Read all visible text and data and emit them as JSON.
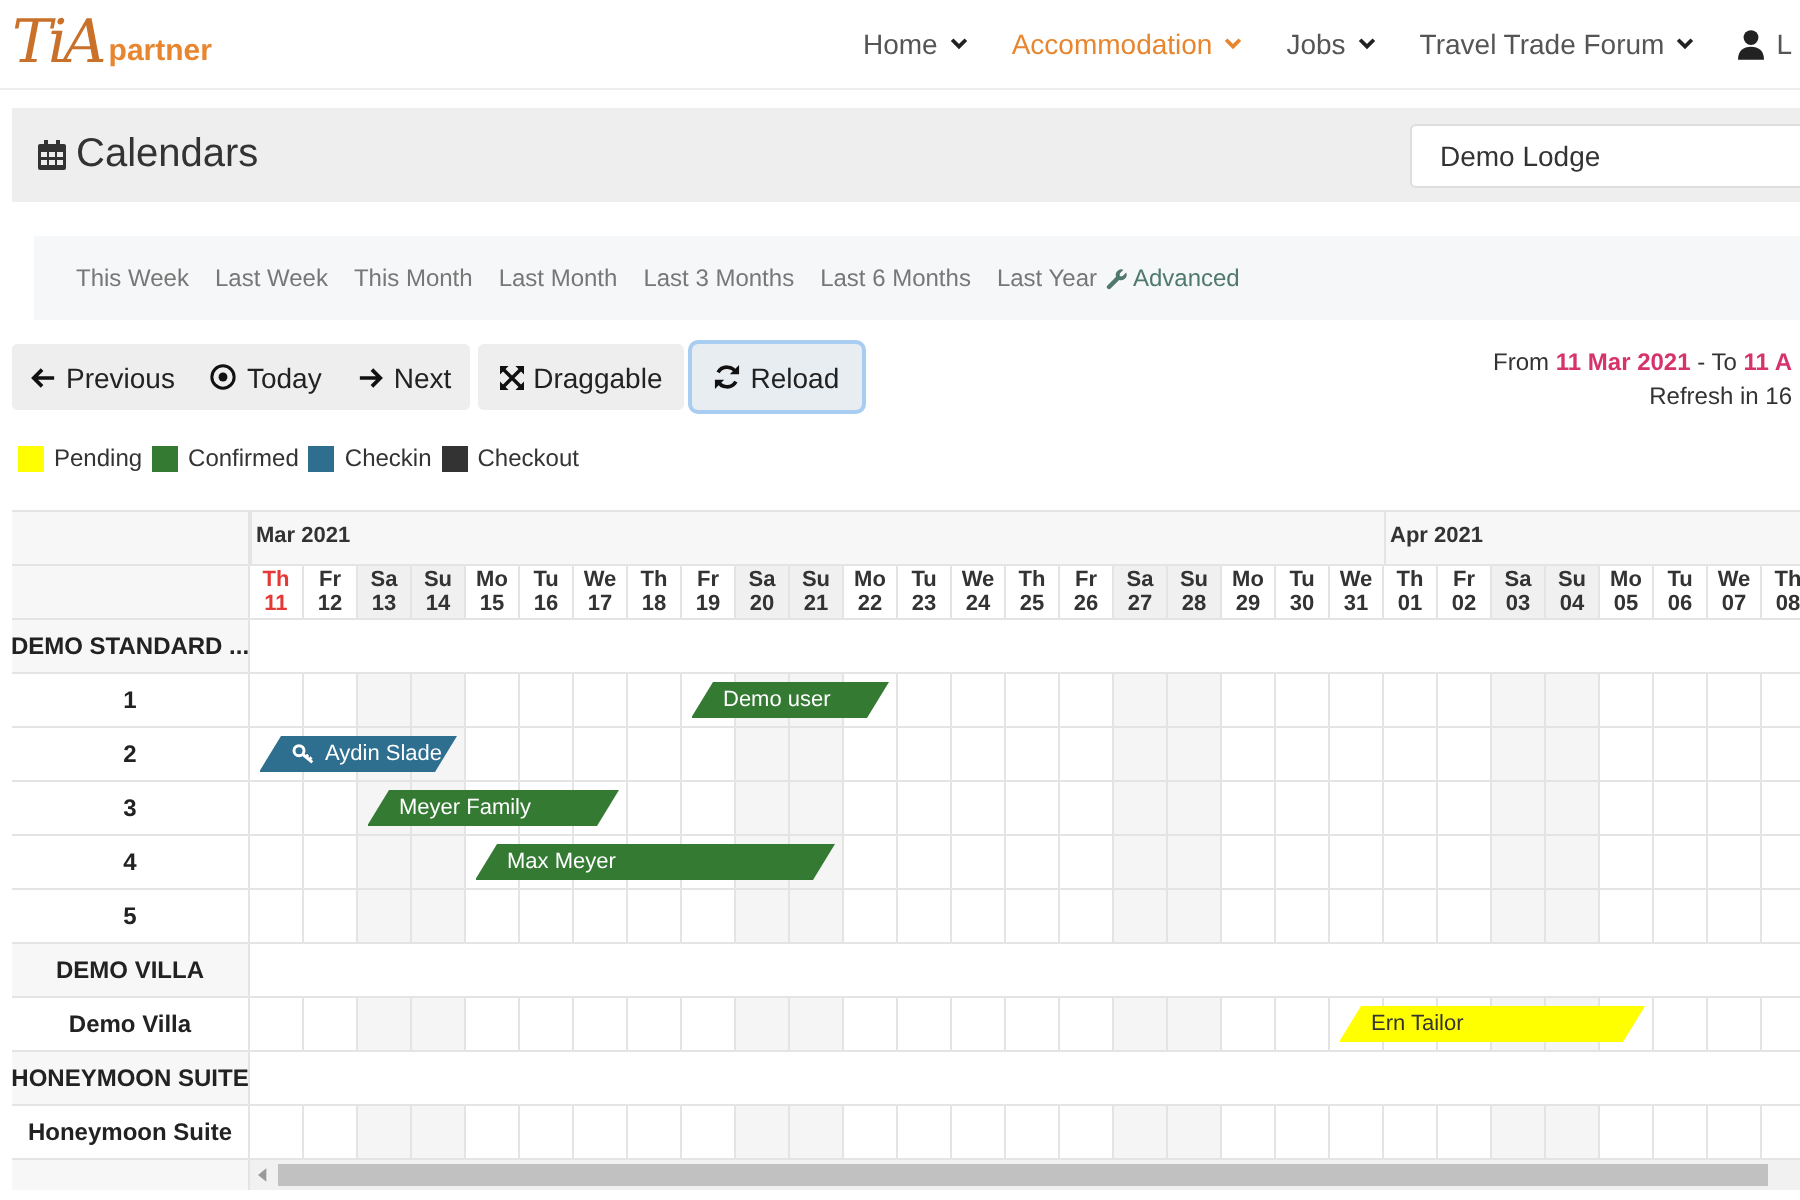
{
  "logo": {
    "mark": "TiA",
    "text": "partner"
  },
  "nav": [
    {
      "label": "Home",
      "selected": false,
      "caret": true
    },
    {
      "label": "Accommodation",
      "selected": true,
      "caret": true
    },
    {
      "label": "Jobs",
      "selected": false,
      "caret": true
    },
    {
      "label": "Travel Trade Forum",
      "selected": false,
      "caret": true
    },
    {
      "label": "L",
      "selected": false,
      "caret": false
    }
  ],
  "page_title": "Calendars",
  "property_select": {
    "value": "Demo Lodge"
  },
  "filters": [
    "This Week",
    "Last Week",
    "This Month",
    "Last Month",
    "Last 3 Months",
    "Last 6 Months",
    "Last Year"
  ],
  "advanced_link": "Advanced",
  "nav_buttons": [
    {
      "label": "Previous",
      "kind": "prev"
    },
    {
      "label": "Today",
      "kind": "today"
    },
    {
      "label": "Next",
      "kind": "next"
    }
  ],
  "draggable_button": "Draggable",
  "reload_button": {
    "label": "Reload",
    "focused": true
  },
  "range": "From **11 Mar 2021** - To **11 A**",
  "refresh": "Refresh in 16",
  "legend": [
    {
      "label": "Pending",
      "color": "#ffff00"
    },
    {
      "label": "Confirmed",
      "color": "#347a33"
    },
    {
      "label": "Checkin",
      "color": "#2e6e8e"
    },
    {
      "label": "Checkout",
      "color": "#333333"
    }
  ],
  "months": [
    {
      "label": "Mar 2021",
      "days": [
        {
          "weekday": "Th",
          "day": "11",
          "today": true,
          "weekend": false
        },
        {
          "weekday": "Fr",
          "day": "12",
          "today": false,
          "weekend": false
        },
        {
          "weekday": "Sa",
          "day": "13",
          "today": false,
          "weekend": true
        },
        {
          "weekday": "Su",
          "day": "14",
          "today": false,
          "weekend": true
        },
        {
          "weekday": "Mo",
          "day": "15",
          "today": false,
          "weekend": false
        },
        {
          "weekday": "Tu",
          "day": "16",
          "today": false,
          "weekend": false
        },
        {
          "weekday": "We",
          "day": "17",
          "today": false,
          "weekend": false
        },
        {
          "weekday": "Th",
          "day": "18",
          "today": false,
          "weekend": false
        },
        {
          "weekday": "Fr",
          "day": "19",
          "today": false,
          "weekend": false
        },
        {
          "weekday": "Sa",
          "day": "20",
          "today": false,
          "weekend": true
        },
        {
          "weekday": "Su",
          "day": "21",
          "today": false,
          "weekend": true
        },
        {
          "weekday": "Mo",
          "day": "22",
          "today": false,
          "weekend": false
        },
        {
          "weekday": "Tu",
          "day": "23",
          "today": false,
          "weekend": false
        },
        {
          "weekday": "We",
          "day": "24",
          "today": false,
          "weekend": false
        },
        {
          "weekday": "Th",
          "day": "25",
          "today": false,
          "weekend": false
        },
        {
          "weekday": "Fr",
          "day": "26",
          "today": false,
          "weekend": false
        },
        {
          "weekday": "Sa",
          "day": "27",
          "today": false,
          "weekend": true
        },
        {
          "weekday": "Su",
          "day": "28",
          "today": false,
          "weekend": true
        },
        {
          "weekday": "Mo",
          "day": "29",
          "today": false,
          "weekend": false
        },
        {
          "weekday": "Tu",
          "day": "30",
          "today": false,
          "weekend": false
        },
        {
          "weekday": "We",
          "day": "31",
          "today": false,
          "weekend": false
        }
      ]
    },
    {
      "label": "Apr 2021",
      "days": [
        {
          "weekday": "Th",
          "day": "01",
          "today": false,
          "weekend": false
        },
        {
          "weekday": "Fr",
          "day": "02",
          "today": false,
          "weekend": false
        },
        {
          "weekday": "Sa",
          "day": "03",
          "today": false,
          "weekend": true
        },
        {
          "weekday": "Su",
          "day": "04",
          "today": false,
          "weekend": true
        },
        {
          "weekday": "Mo",
          "day": "05",
          "today": false,
          "weekend": false
        },
        {
          "weekday": "Tu",
          "day": "06",
          "today": false,
          "weekend": false
        },
        {
          "weekday": "We",
          "day": "07",
          "today": false,
          "weekend": false
        },
        {
          "weekday": "Th",
          "day": "08",
          "today": false,
          "weekend": false
        }
      ]
    }
  ],
  "rows": [
    {
      "label": "DEMO STANDARD ...",
      "kind": "group",
      "bookings": []
    },
    {
      "label": "1",
      "kind": "unit",
      "bookings": [
        {
          "guest": "Demo user",
          "color": "#347a33",
          "checked_in": false
        }
      ]
    },
    {
      "label": "2",
      "kind": "unit",
      "bookings": [
        {
          "guest": "Aydin Slade",
          "color": "#2e6e8e",
          "checked_in": true
        }
      ]
    },
    {
      "label": "3",
      "kind": "unit",
      "bookings": [
        {
          "guest": "Meyer Family",
          "color": "#347a33",
          "checked_in": false
        }
      ]
    },
    {
      "label": "4",
      "kind": "unit",
      "bookings": [
        {
          "guest": "Max Meyer",
          "color": "#347a33",
          "checked_in": false
        }
      ]
    },
    {
      "label": "5",
      "kind": "unit",
      "bookings": []
    },
    {
      "label": "DEMO VILLA",
      "kind": "group",
      "bookings": []
    },
    {
      "label": "Demo Villa",
      "kind": "unit",
      "bookings": [
        {
          "guest": "Ern Tailor",
          "color": "#ffff00",
          "checked_in": false
        }
      ]
    },
    {
      "label": "HONEYMOON SUITE",
      "kind": "group",
      "bookings": []
    },
    {
      "label": "Honeymoon Suite",
      "kind": "unit",
      "bookings": []
    }
  ]
}
